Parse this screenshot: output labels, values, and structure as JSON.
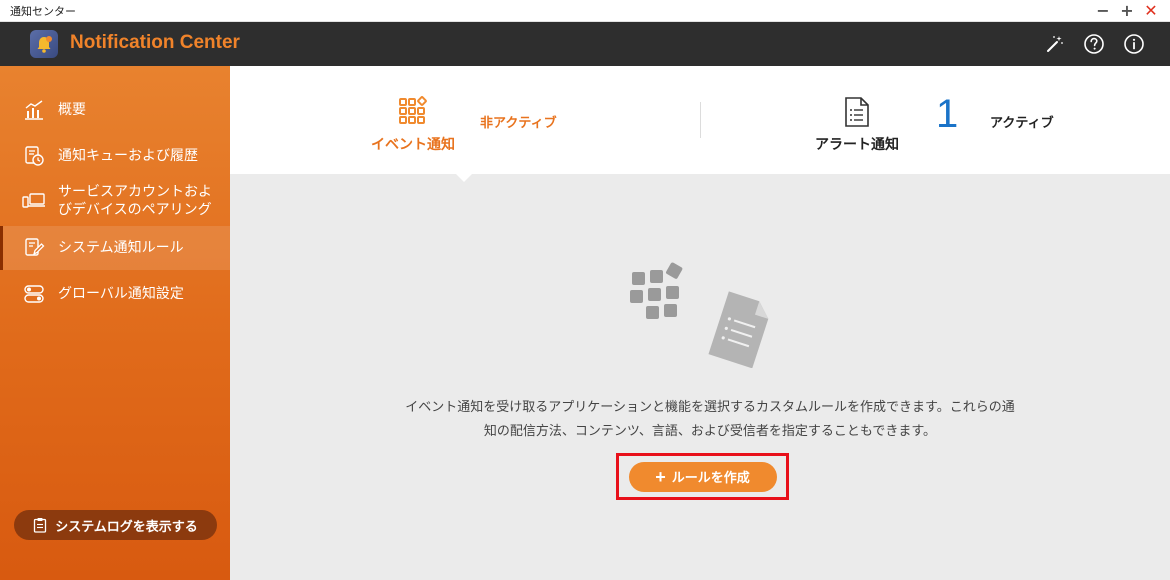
{
  "window": {
    "title": "通知センター",
    "minimize": "−",
    "maximize": "+",
    "close": "✕"
  },
  "header": {
    "app_title": "Notification Center",
    "icons": [
      "magic-wand-icon",
      "help-icon",
      "info-icon"
    ]
  },
  "sidebar": {
    "items": [
      {
        "label": "概要",
        "icon": "chart-icon"
      },
      {
        "label": "通知キューおよび履歴",
        "icon": "history-icon"
      },
      {
        "label_line1": "サービスアカウントおよ",
        "label_line2": "びデバイスのペアリング",
        "icon": "devices-icon"
      },
      {
        "label": "システム通知ルール",
        "icon": "rule-edit-icon",
        "active": true
      },
      {
        "label": "グローバル通知設定",
        "icon": "toggle-settings-icon"
      }
    ],
    "syslog_button": "システムログを表示する"
  },
  "tabs": {
    "event": {
      "label": "イベント通知",
      "status": "非アクティブ",
      "selected": true
    },
    "alert": {
      "label": "アラート通知",
      "status": "アクティブ",
      "count": "1"
    }
  },
  "main": {
    "description_line1": "イベント通知を受け取るアプリケーションと機能を選択するカスタムルールを作成できます。これらの通",
    "description_line2": "知の配信方法、コンテンツ、言語、および受信者を指定することもできます。",
    "create_button": "ルールを作成",
    "create_icon": "+"
  },
  "colors": {
    "accent": "#f08a2e",
    "header_bg": "#2e2e2e",
    "sidebar_bg": "#e06a1a",
    "highlight_border": "#e8101a",
    "active_status": "#1a73c8"
  }
}
